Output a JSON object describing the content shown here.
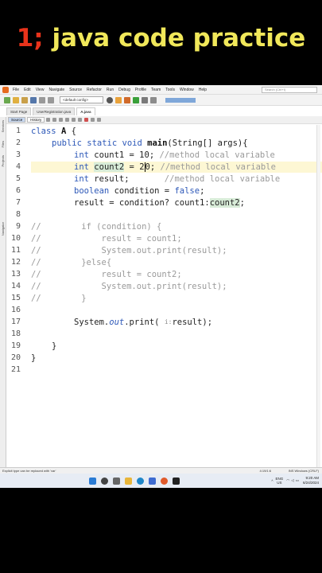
{
  "video_title": {
    "number": "1;",
    "text": " java code practice"
  },
  "menu": [
    "File",
    "Edit",
    "View",
    "Navigate",
    "Source",
    "Refactor",
    "Run",
    "Debug",
    "Profile",
    "Team",
    "Tools",
    "Window",
    "Help"
  ],
  "search_placeholder": "Search (Ctrl+I)",
  "toolbar": {
    "config": "<default config>"
  },
  "tabs": [
    "Start Page",
    "UserRegistration.java",
    "A.java"
  ],
  "editor_tabs": [
    "Source",
    "History"
  ],
  "side_strip": [
    "Services",
    "Files",
    "Projects",
    "Navigator"
  ],
  "line_numbers": [
    "1",
    "2",
    "3",
    "4",
    "5",
    "6",
    "7",
    "8",
    "9",
    "10",
    "11",
    "12",
    "13",
    "14",
    "15",
    "16",
    "17",
    "18",
    "19",
    "20",
    "21"
  ],
  "code": {
    "l1_kw": "class",
    "l1_name": "A",
    "l1_rest": " {",
    "l2_kw": "public static void",
    "l2_name": "main",
    "l2_rest": "(String[] args){",
    "l3_kw": "int",
    "l3_rest": " count1 = 10; ",
    "l3_cm": "//method local variable",
    "l4_kw": "int",
    "l4_name": "count2",
    "l4_pre": " = 2",
    "l4_post": "0; ",
    "l4_cm": "//method local variable",
    "l5_kw": "int",
    "l5_rest": " result;       ",
    "l5_cm": "//method local variable",
    "l6_kw": "boolean",
    "l6_rest": " condition = ",
    "l6_kw2": "false",
    "l6_end": ";",
    "l7_rest": "result = condition? count1:",
    "l7_hi": "count2",
    "l7_end": ";",
    "l10": "//        if (condition) {",
    "l11": "//            result = count1;",
    "l12": "//            System.out.print(result);",
    "l13": "//        }else{",
    "l14": "//            result = count2;",
    "l15": "//            System.out.print(result);",
    "l16": "//        }",
    "l17_a": "System.",
    "l17_out": "out",
    "l17_b": ".print( ",
    "l17_ph": "i:",
    "l17_c": "result);",
    "l19": "}",
    "l20": "}"
  },
  "status": {
    "hint": "Explicit type can be replaced with 'var'",
    "position": "4:19/1:6",
    "mode": "INS Windows (CRLF)"
  },
  "taskbar": {
    "lang": "ENG",
    "region": "US",
    "time": "9:20 AM",
    "date": "6/24/2024"
  }
}
